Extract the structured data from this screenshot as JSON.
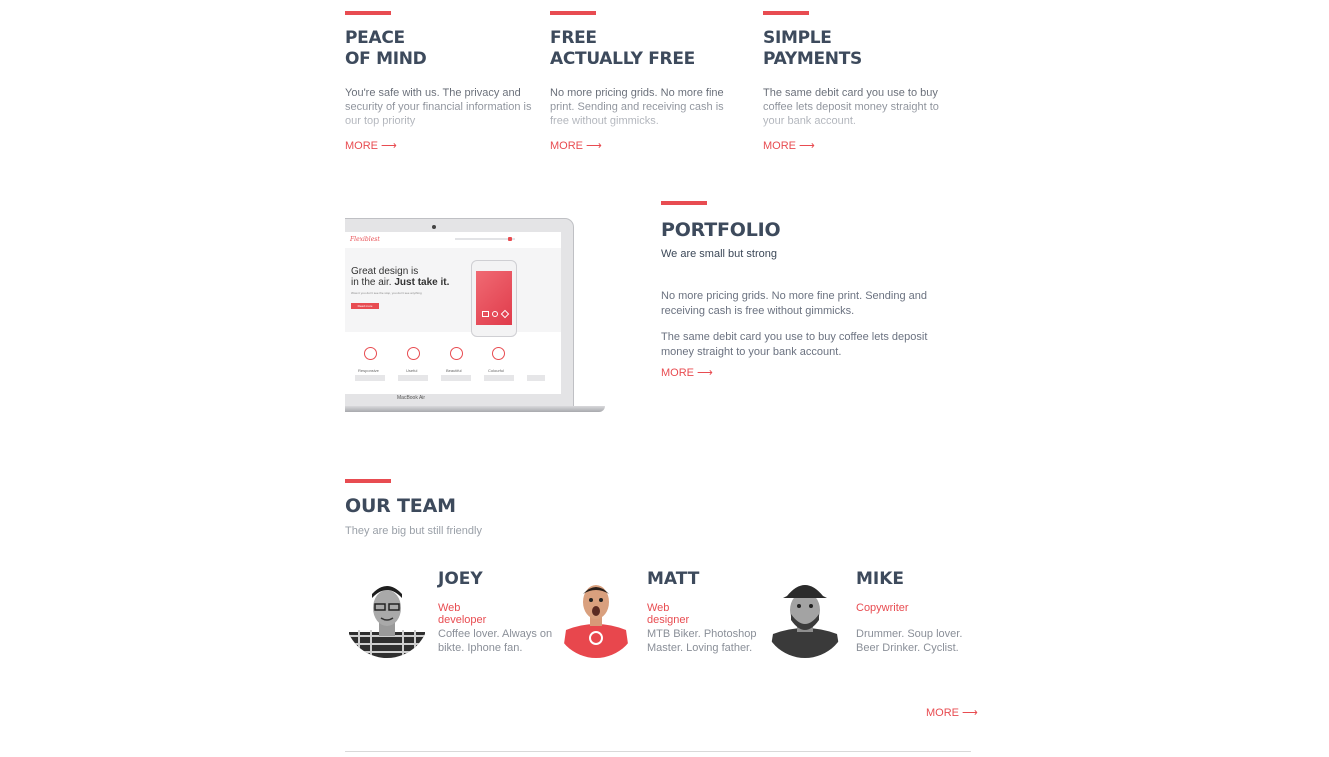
{
  "features": [
    {
      "line1": "PEACE",
      "line2": "OF MIND",
      "text": "You're safe with us. The privacy and security of your financial information is our top priority",
      "more": "MORE"
    },
    {
      "line1": "FREE",
      "line2": "ACTUALLY FREE",
      "text": "No more pricing grids. No more fine print. Sending and receiving cash is free without gimmicks.",
      "more": "MORE"
    },
    {
      "line1": "SIMPLE",
      "line2": "PAYMENTS",
      "text": "The same debit card you use to buy coffee lets deposit money straight to your bank account.",
      "more": "MORE"
    }
  ],
  "arrow_glyph": "⟶",
  "portfolio": {
    "title": "PORTFOLIO",
    "subtitle": "We are small but strong",
    "para1": "No more pricing grids. No more fine print. Sending and receiving cash is free without gimmicks.",
    "para2": "The same debit card you use to buy coffee lets deposit money straight to your bank account.",
    "more": "MORE"
  },
  "laptop": {
    "logo": "Flexiblest",
    "headline1": "Great design is",
    "headline2a": "in the air. ",
    "headline2b": "Just take it.",
    "tagline": "Wow it you don't see the stop, you don't see anything",
    "cta": "Read more",
    "features": [
      "Responsive",
      "Useful",
      "Beautiful",
      "Colourful"
    ],
    "brand": "MacBook Air"
  },
  "team": {
    "title": "OUR TEAM",
    "subtitle": "They are big but still friendly",
    "members": [
      {
        "name": "JOEY",
        "role": "Web developer",
        "bio": "Coffee lover. Always on bikte. Iphone fan."
      },
      {
        "name": "MATT",
        "role": "Web designer",
        "bio": "MTB Biker. Photoshop Master. Loving father."
      },
      {
        "name": "MIKE",
        "role": "Copywriter",
        "bio": "Drummer. Soup lover. Beer Drinker. Cyclist."
      }
    ],
    "more": "MORE"
  },
  "colors": {
    "accent": "#e84c51",
    "heading": "#3d4a5c",
    "text": "#6b7280"
  }
}
